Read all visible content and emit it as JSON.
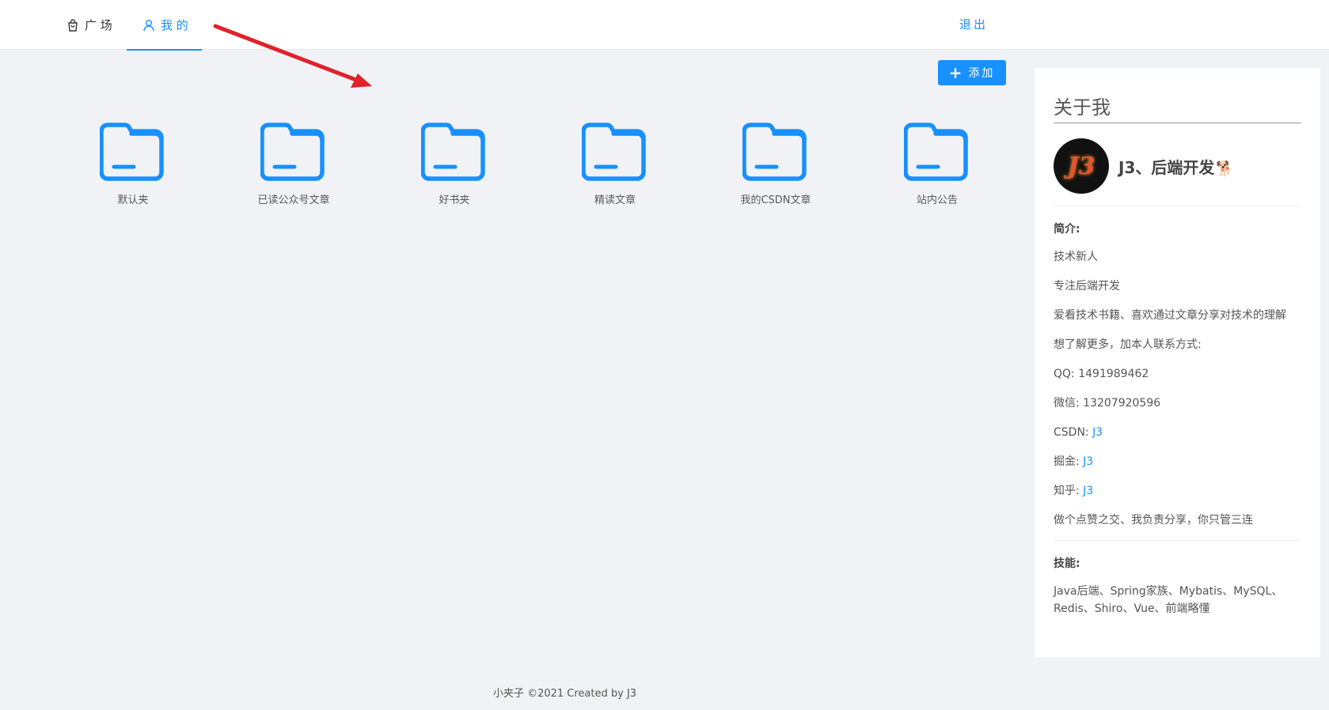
{
  "nav": {
    "square_label": "广 场",
    "mine_label": "我 的",
    "logout_label": "退出"
  },
  "toolbar": {
    "add_label": "添加"
  },
  "folders": [
    {
      "label": "默认夹"
    },
    {
      "label": "已读公众号文章"
    },
    {
      "label": "好书夹"
    },
    {
      "label": "精读文章"
    },
    {
      "label": "我的CSDN文章"
    },
    {
      "label": "站内公告"
    }
  ],
  "about": {
    "title": "关于我",
    "avatar_text": "J3",
    "nickname": "J3、后端开发",
    "intro_heading": "简介:",
    "intro_lines": [
      "技术新人",
      "专注后端开发",
      "爱看技术书籍、喜欢通过文章分享对技术的理解",
      "想了解更多，加本人联系方式:"
    ],
    "qq_label": "QQ: ",
    "qq_value": "1491989462",
    "wechat_label": "微信: ",
    "wechat_value": "13207920596",
    "csdn_label": "CSDN: ",
    "csdn_link": "J3",
    "juejin_label": "掘金: ",
    "juejin_link": "J3",
    "zhihu_label": "知乎: ",
    "zhihu_link": "J3",
    "closing": "做个点赞之交、我负责分享，你只管三连",
    "skills_heading": "技能:",
    "skills_text": "Java后端、Spring家族、Mybatis、MySQL、Redis、Shiro、Vue、前端略懂"
  },
  "footer": {
    "text": "小夹子 ©2021 Created by J3"
  },
  "colors": {
    "accent": "#1890ff",
    "arrow": "#e0222b",
    "background": "#f0f2f5"
  }
}
